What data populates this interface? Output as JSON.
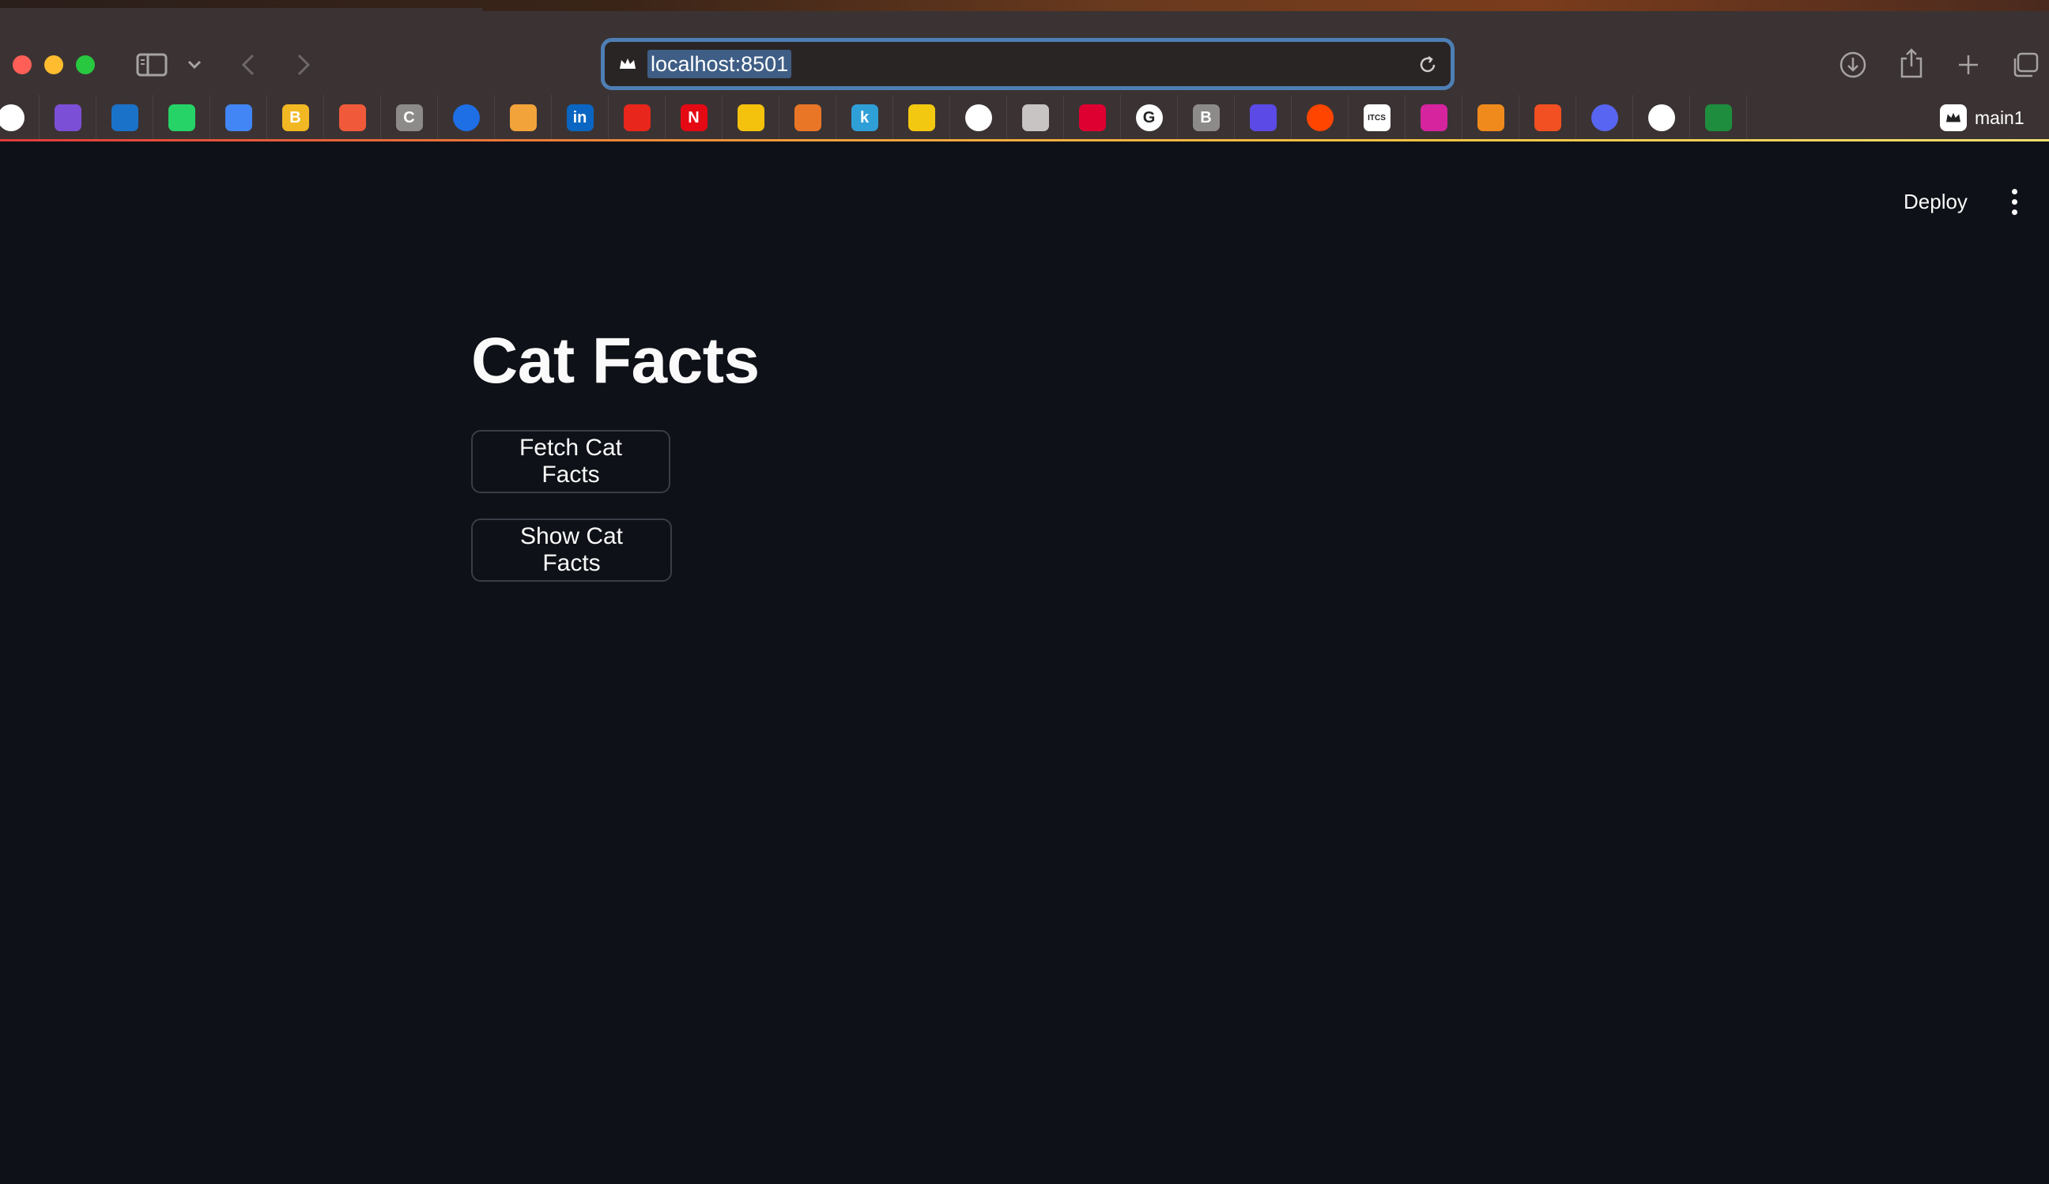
{
  "browser": {
    "address_bar": {
      "url": "localhost:8501"
    },
    "bookmarks": [
      {
        "name": "github",
        "icon": "github-icon",
        "color": "#ffffff"
      },
      {
        "name": "mail",
        "icon": "mail-icon",
        "color": "#7b4fd6"
      },
      {
        "name": "outlook",
        "icon": "outlook-icon",
        "color": "#1a73c8"
      },
      {
        "name": "whatsapp",
        "icon": "whatsapp-icon",
        "color": "#25d366"
      },
      {
        "name": "translate",
        "icon": "translate-icon",
        "color": "#4285f4"
      },
      {
        "name": "bold-b",
        "icon": "b-icon",
        "glyph": "B",
        "color": "#f2b824"
      },
      {
        "name": "diamond",
        "icon": "diamond-icon",
        "color": "#f05a3a"
      },
      {
        "name": "c-app",
        "icon": "c-icon",
        "glyph": "C",
        "color": "#8d8a8a"
      },
      {
        "name": "ring",
        "icon": "ring-icon",
        "color": "#1e6ee6"
      },
      {
        "name": "envelope",
        "icon": "envelope-icon",
        "color": "#f2a33a"
      },
      {
        "name": "linkedin",
        "icon": "linkedin-icon",
        "glyph": "in",
        "color": "#0a66c2"
      },
      {
        "name": "adobe",
        "icon": "adobe-icon",
        "color": "#e8261b"
      },
      {
        "name": "netflix",
        "icon": "netflix-icon",
        "glyph": "N",
        "color": "#e50914"
      },
      {
        "name": "drive",
        "icon": "drive-icon",
        "color": "#f4c20d"
      },
      {
        "name": "tableau",
        "icon": "tableau-icon",
        "color": "#e97627"
      },
      {
        "name": "k-app",
        "icon": "k-icon",
        "glyph": "k",
        "color": "#2f9fd8"
      },
      {
        "name": "powerbi",
        "icon": "powerbi-icon",
        "color": "#f2c811"
      },
      {
        "name": "crest",
        "icon": "crest-icon",
        "color": "#ffffff"
      },
      {
        "name": "swirl",
        "icon": "swirl-icon",
        "color": "#c8c4c4"
      },
      {
        "name": "angular",
        "icon": "angular-icon",
        "color": "#dd0031"
      },
      {
        "name": "google",
        "icon": "google-icon",
        "glyph": "G",
        "color": "#ffffff"
      },
      {
        "name": "b-gray",
        "icon": "b-gray-icon",
        "glyph": "B",
        "color": "#8d8a8a"
      },
      {
        "name": "lines",
        "icon": "lines-icon",
        "color": "#5b4ae6"
      },
      {
        "name": "reddit",
        "icon": "reddit-icon",
        "color": "#ff4500"
      },
      {
        "name": "itcs",
        "icon": "itcs-icon",
        "glyph": "ITCS",
        "color": "#ffffff"
      },
      {
        "name": "instagram",
        "icon": "instagram-icon",
        "color": "#d6249f"
      },
      {
        "name": "mistral",
        "icon": "mistral-icon",
        "color": "#f08a1c"
      },
      {
        "name": "microsoft",
        "icon": "microsoft-icon",
        "color": "#f25022"
      },
      {
        "name": "discord",
        "icon": "discord-icon",
        "color": "#5865f2"
      },
      {
        "name": "openai",
        "icon": "openai-icon",
        "color": "#ffffff"
      },
      {
        "name": "classroom",
        "icon": "classroom-icon",
        "color": "#1e8e3e"
      }
    ],
    "folder": {
      "label": "main1",
      "icon": "crown-icon"
    }
  },
  "app": {
    "header": {
      "deploy_label": "Deploy",
      "menu_icon": "vertical-dots-icon"
    },
    "title": "Cat Facts",
    "buttons": {
      "fetch_label": "Fetch Cat Facts",
      "show_label": "Show Cat Facts"
    }
  },
  "colors": {
    "app_background": "#0e1117",
    "browser_chrome": "#3b3333",
    "address_focus_ring": "#4d7fb4",
    "text": "#fafafa",
    "button_border": "#3a3d47"
  }
}
